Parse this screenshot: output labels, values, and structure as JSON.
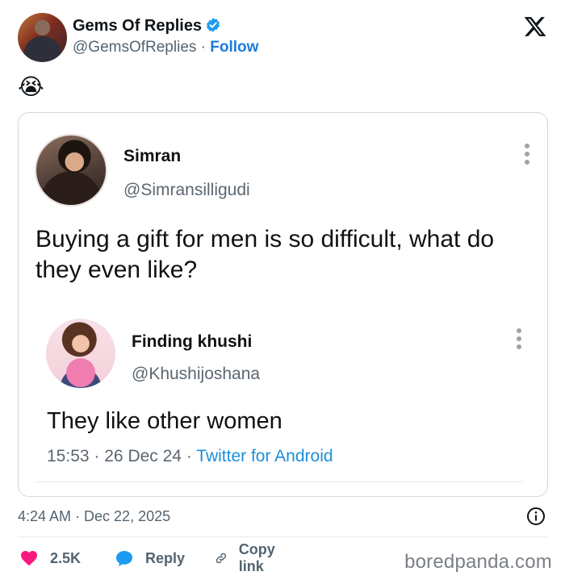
{
  "post": {
    "author_name": "Gems Of Replies",
    "author_handle": "@GemsOfReplies",
    "separator": "·",
    "follow_label": "Follow",
    "emoji": "😭",
    "timestamp": "4:24 AM · Dec 22, 2025",
    "like_count": "2.5K",
    "reply_label": "Reply",
    "copy_link_label": "Copy link"
  },
  "screenshot": {
    "original": {
      "name": "Simran",
      "handle": "@Simransilligudi",
      "text": "Buying a gift for men is so difficult, what do they even like?"
    },
    "reply": {
      "name": "Finding khushi",
      "handle": "@Khushijoshana",
      "text": "They like other women",
      "time": "15:53",
      "date": "26 Dec 24",
      "client": "Twitter for Android",
      "separator": "·"
    }
  },
  "watermark": "boredpanda.com",
  "colors": {
    "accent": "#1d7bd8",
    "like": "#f91880",
    "reply": "#1d9bf0",
    "verified": "#1d9bf0",
    "muted": "#536471"
  },
  "icons": [
    "verified-badge-icon",
    "x-logo-icon",
    "kebab-menu-icon",
    "info-icon",
    "heart-icon",
    "reply-bubble-icon",
    "link-icon"
  ]
}
